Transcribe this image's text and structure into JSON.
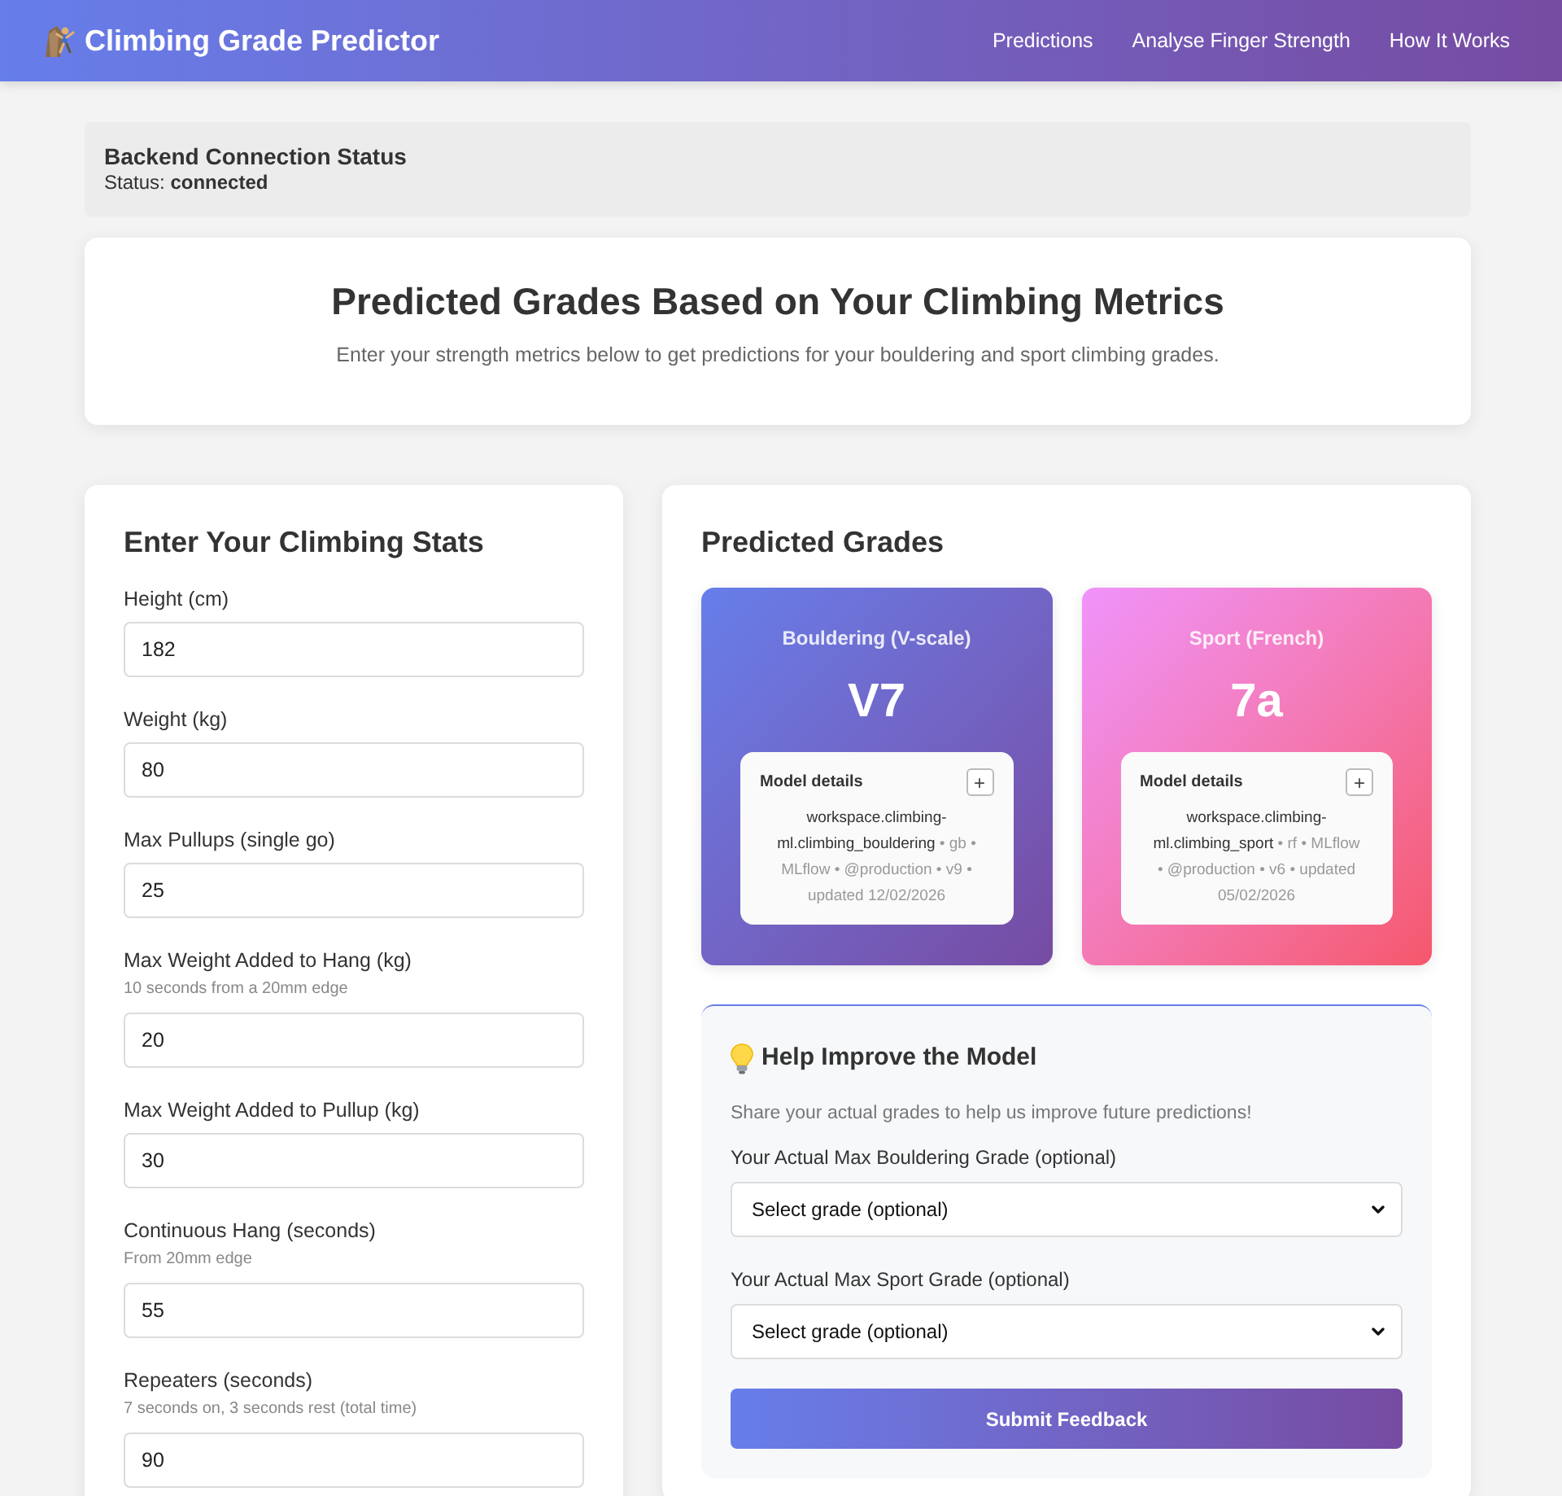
{
  "header": {
    "title": "Climbing Grade Predictor",
    "nav": [
      {
        "label": "Predictions"
      },
      {
        "label": "Analyse Finger Strength"
      },
      {
        "label": "How It Works"
      }
    ]
  },
  "status": {
    "title": "Backend Connection Status",
    "text": "Status: **connected**"
  },
  "hero": {
    "title": "Predicted Grades Based on Your Climbing Metrics",
    "subtitle": "Enter your strength metrics below to get predictions for your bouldering and sport climbing grades."
  },
  "stats_form": {
    "title": "Enter Your Climbing Stats",
    "fields": [
      {
        "label": "Height (cm)",
        "value": "182"
      },
      {
        "label": "Weight (kg)",
        "value": "80"
      },
      {
        "label": "Max Pullups (single go)",
        "value": "25"
      },
      {
        "label": "Max Weight Added to Hang (kg)",
        "hint": "10 seconds from a 20mm edge",
        "value": "20"
      },
      {
        "label": "Max Weight Added to Pullup (kg)",
        "value": "30"
      },
      {
        "label": "Continuous Hang (seconds)",
        "hint": "From 20mm edge",
        "value": "55"
      },
      {
        "label": "Repeaters (seconds)",
        "hint": "7 seconds on, 3 seconds rest (total time)",
        "value": "90"
      }
    ]
  },
  "predictions": {
    "title": "Predicted Grades",
    "cards": [
      {
        "kind": "bouldering",
        "label": "Bouldering (V-scale)",
        "grade": "V7",
        "details_title": "Model details",
        "toggle": "+",
        "details": "**workspace.climbing-ml.climbing_bouldering** • gb • MLflow • @production • v9 • updated 12/02/2026"
      },
      {
        "kind": "sport",
        "label": "Sport (French)",
        "grade": "7a",
        "details_title": "Model details",
        "toggle": "+",
        "details": "**workspace.climbing-ml.climbing_sport** • rf • MLflow • @production • v6 • updated 05/02/2026"
      }
    ]
  },
  "feedback": {
    "title": "Help Improve the Model",
    "text": "Share your actual grades to help us improve future predictions!",
    "selects": [
      {
        "label": "Your Actual Max Bouldering Grade (optional)",
        "value": "Select grade (optional)"
      },
      {
        "label": "Your Actual Max Sport Grade (optional)",
        "value": "Select grade (optional)"
      }
    ],
    "button": "Submit Feedback"
  }
}
